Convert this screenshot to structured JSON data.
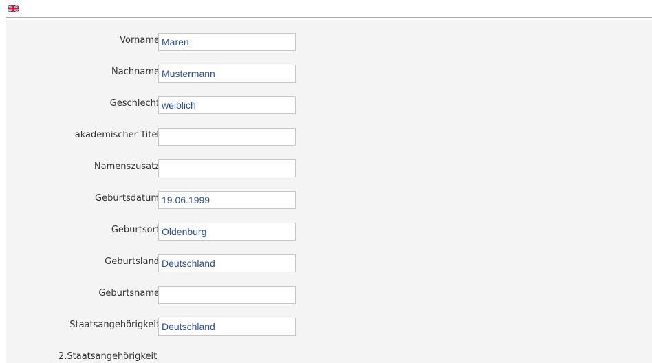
{
  "header": {
    "language_flag_icon": "uk-flag-icon"
  },
  "form": {
    "fields": [
      {
        "label": "Vorname",
        "value": "Maren"
      },
      {
        "label": "Nachname",
        "value": "Mustermann"
      },
      {
        "label": "Geschlecht",
        "value": "weiblich"
      },
      {
        "label": "akademischer Titel",
        "value": ""
      },
      {
        "label": "Namenszusatz",
        "value": ""
      },
      {
        "label": "Geburtsdatum",
        "value": "19.06.1999"
      },
      {
        "label": "Geburtsort",
        "value": "Oldenburg"
      },
      {
        "label": "Geburtsland",
        "value": "Deutschland"
      },
      {
        "label": "Geburtsname",
        "value": ""
      },
      {
        "label": "Staatsangehörigkeit",
        "value": "Deutschland"
      }
    ],
    "second_nationality_label": "2.Staatsangehörigkeit"
  },
  "colors": {
    "panel_bg": "#f4f4f4",
    "value_text": "#2a4fa0",
    "label_text": "#333333",
    "field_border": "#c7c7c7"
  }
}
